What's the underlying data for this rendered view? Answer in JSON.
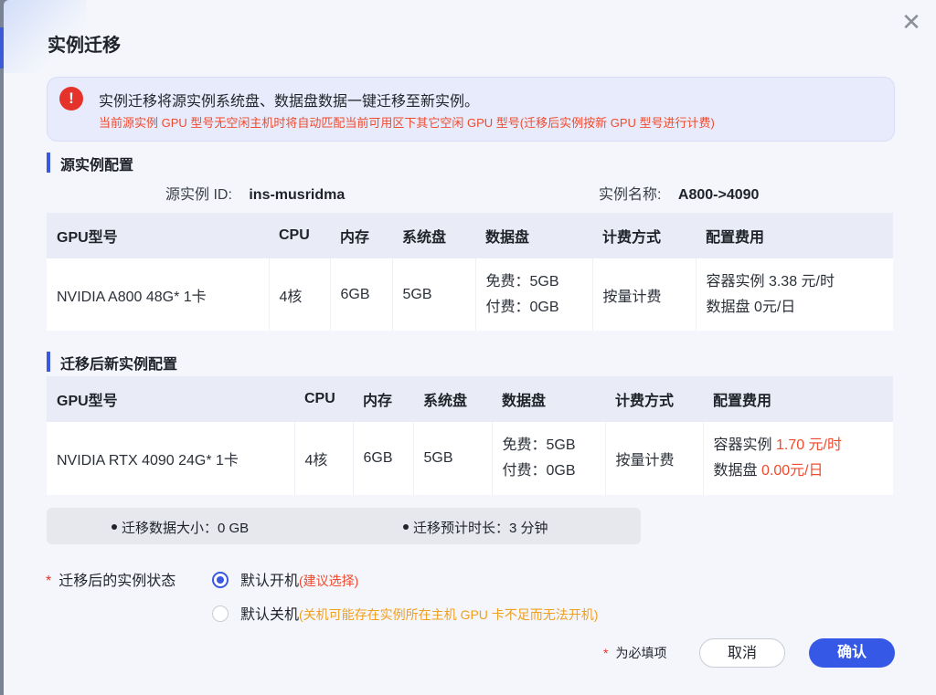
{
  "dialog": {
    "title": "实例迁移",
    "close_glyph": "✕"
  },
  "alert": {
    "icon_glyph": "!",
    "main": "实例迁移将源实例系统盘、数据盘数据一键迁移至新实例。",
    "sub": "当前源实例 GPU 型号无空闲主机时将自动匹配当前可用区下其它空闲 GPU 型号(迁移后实例按新 GPU 型号进行计费)"
  },
  "source": {
    "section_title": "源实例配置",
    "id_label": "源实例 ID:",
    "id_value": "ins-musridma",
    "name_label": "实例名称:",
    "name_value": "A800->4090",
    "headers": [
      "GPU型号",
      "CPU",
      "内存",
      "系统盘",
      "数据盘",
      "计费方式",
      "配置费用"
    ],
    "row": {
      "gpu": "NVIDIA A800 48G* 1卡",
      "cpu": "4核",
      "memory": "6GB",
      "system_disk": "5GB",
      "data_disk_free": "免费：5GB",
      "data_disk_paid": "付费：0GB",
      "billing": "按量计费",
      "fee_container": "容器实例 3.38 元/时",
      "fee_disk": "数据盘 0元/日"
    }
  },
  "target": {
    "section_title": "迁移后新实例配置",
    "headers": [
      "GPU型号",
      "CPU",
      "内存",
      "系统盘",
      "数据盘",
      "计费方式",
      "配置费用"
    ],
    "row": {
      "gpu": "NVIDIA RTX 4090 24G* 1卡",
      "cpu": "4核",
      "memory": "6GB",
      "system_disk": "5GB",
      "data_disk_free": "免费：5GB",
      "data_disk_paid": "付费：0GB",
      "billing": "按量计费",
      "fee_container_label": "容器实例",
      "fee_container_value": "1.70 元/时",
      "fee_disk_label": "数据盘",
      "fee_disk_value": "0.00元/日"
    }
  },
  "summary": {
    "data_size": "迁移数据大小：0 GB",
    "duration": "迁移预计时长：3 分钟"
  },
  "state": {
    "required_star": "*",
    "label": "迁移后的实例状态",
    "option_on": "默认开机",
    "option_on_hint": "(建议选择)",
    "option_off": "默认关机",
    "option_off_hint": "(关机可能存在实例所在主机 GPU 卡不足而无法开机)",
    "selected": "option_on"
  },
  "footer": {
    "required_note": "为必填项",
    "cancel": "取消",
    "confirm": "确认"
  },
  "colors": {
    "accent": "#3558e6",
    "warning_red": "#f04a2e",
    "warning_orange": "#f0a020"
  }
}
